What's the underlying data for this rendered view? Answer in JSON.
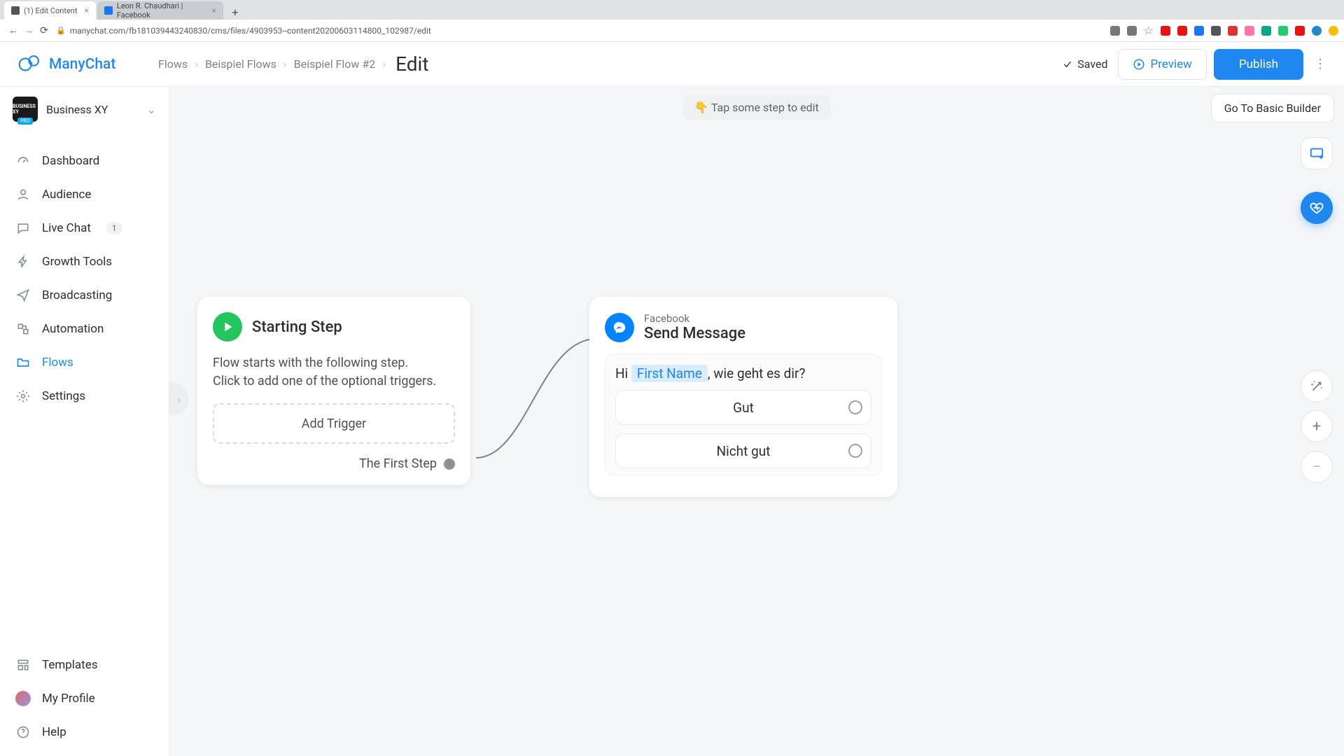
{
  "browser": {
    "tabs": [
      {
        "title": "(1) Edit Content",
        "active": true
      },
      {
        "title": "Leon R. Chaudhari | Facebook",
        "active": false
      }
    ],
    "url": "manychat.com/fb181039443240830/cms/files/4903953--content20200603114800_102987/edit"
  },
  "brand": "ManyChat",
  "workspace": {
    "name": "Business XY",
    "badge": "PRO"
  },
  "breadcrumbs": {
    "a": "Flows",
    "b": "Beispiel Flows",
    "c": "Beispiel Flow #2",
    "current": "Edit"
  },
  "toolbar": {
    "saved": "Saved",
    "preview": "Preview",
    "publish": "Publish",
    "basic": "Go To Basic Builder"
  },
  "hint": "👇 Tap some step to edit",
  "nav": {
    "dashboard": "Dashboard",
    "audience": "Audience",
    "livechat": "Live Chat",
    "livechat_badge": "1",
    "growth": "Growth Tools",
    "broadcasting": "Broadcasting",
    "automation": "Automation",
    "flows": "Flows",
    "settings": "Settings",
    "templates": "Templates",
    "profile": "My Profile",
    "help": "Help"
  },
  "start_node": {
    "title": "Starting Step",
    "desc1": "Flow starts with the following step.",
    "desc2": "Click to add one of the optional triggers.",
    "add_trigger": "Add Trigger",
    "first_step": "The First Step"
  },
  "msg_node": {
    "sub": "Facebook",
    "title": "Send Message",
    "text_pre": "Hi ",
    "var": "First Name",
    "text_post": ", wie geht es dir?",
    "replies": [
      "Gut",
      "Nicht gut"
    ]
  }
}
